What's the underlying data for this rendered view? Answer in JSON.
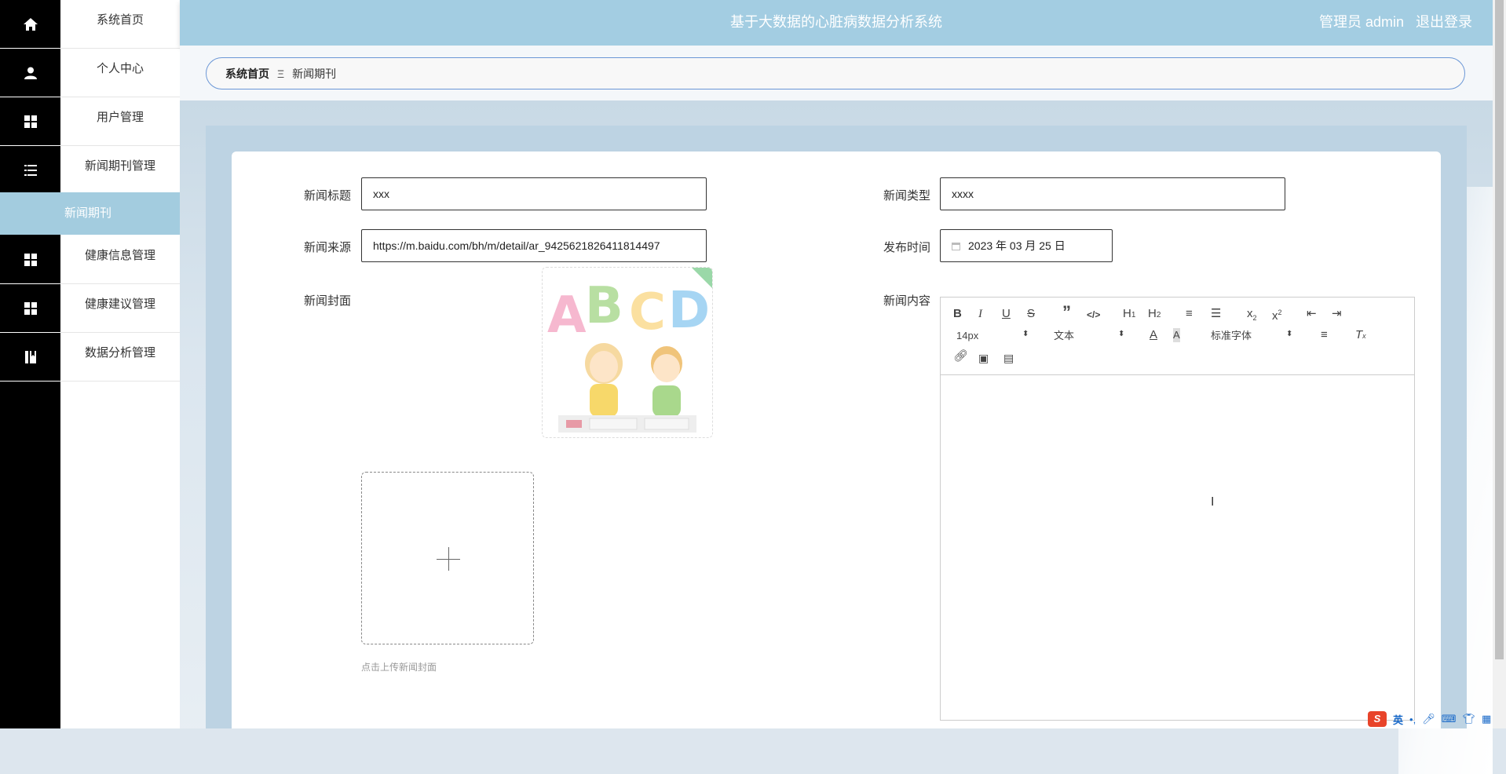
{
  "header": {
    "title": "基于大数据的心脏病数据分析系统",
    "user_label": "管理员 admin",
    "logout": "退出登录"
  },
  "sidebar": {
    "items": [
      {
        "label": "系统首页",
        "icon": "home-icon"
      },
      {
        "label": "个人中心",
        "icon": "user-icon"
      },
      {
        "label": "用户管理",
        "icon": "grid-icon"
      },
      {
        "label": "新闻期刊管理",
        "icon": "list-icon"
      },
      {
        "label": "健康信息管理",
        "icon": "grid-icon"
      },
      {
        "label": "健康建议管理",
        "icon": "grid-icon"
      },
      {
        "label": "数据分析管理",
        "icon": "book-icon"
      }
    ],
    "active_sub": "新闻期刊"
  },
  "breadcrumb": {
    "home": "系统首页",
    "separator": "Ξ",
    "current": "新闻期刊"
  },
  "form": {
    "title_label": "新闻标题",
    "title_value": "xxx",
    "type_label": "新闻类型",
    "type_value": "xxxx",
    "source_label": "新闻来源",
    "source_value": "https://m.baidu.com/bh/m/detail/ar_9425621826411814497",
    "time_label": "发布时间",
    "time_value": "2023 年 03 月 25 日",
    "cover_label": "新闻封面",
    "cover_letters": [
      "A",
      "B",
      "C",
      "D"
    ],
    "upload_hint": "点击上传新闻封面",
    "content_label": "新闻内容"
  },
  "editor": {
    "font_size": "14px",
    "format": "文本",
    "font_family": "标准字体"
  },
  "ime": {
    "logo": "S",
    "mode": "英",
    "punct": "•,"
  },
  "colors": {
    "header_bg": "#a3cde2",
    "active_menu_bg": "#a3ccdf",
    "sidebar_icon_bg": "#000000",
    "breadcrumb_border": "#6b97d6"
  }
}
